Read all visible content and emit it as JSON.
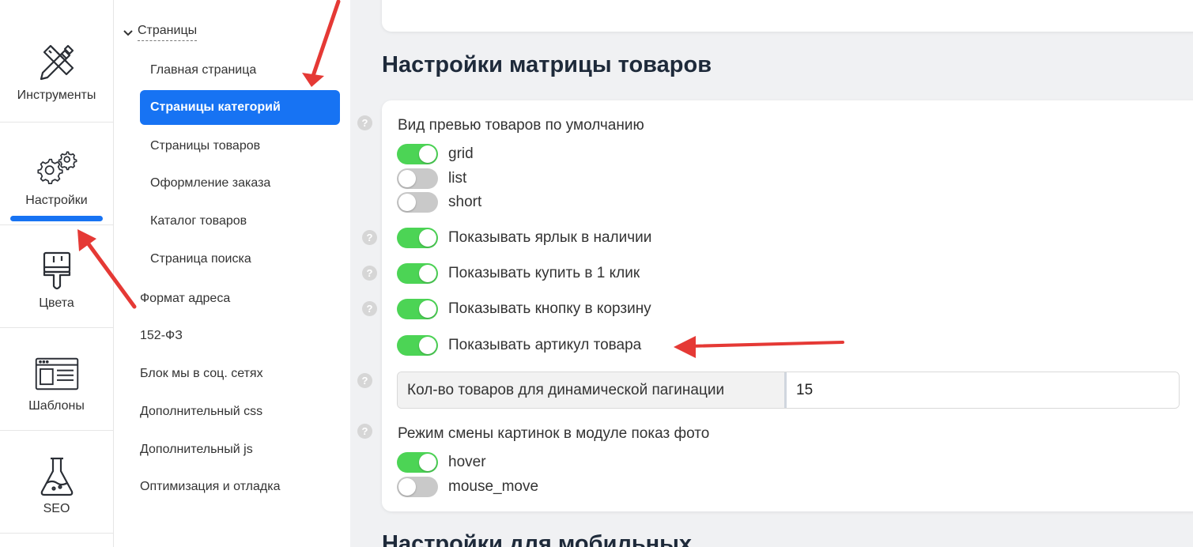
{
  "rail": {
    "items": [
      {
        "label": "Инструменты",
        "icon": "tools-icon"
      },
      {
        "label": "Настройки",
        "icon": "settings-gears-icon"
      },
      {
        "label": "Цвета",
        "icon": "paintbrush-icon"
      },
      {
        "label": "Шаблоны",
        "icon": "template-icon"
      },
      {
        "label": "SEO",
        "icon": "flask-icon"
      }
    ],
    "active": "Настройки"
  },
  "subnav": {
    "section": "Страницы",
    "children": [
      "Главная страница",
      "Страницы категорий",
      "Страницы товаров",
      "Оформление заказа",
      "Каталог товаров",
      "Страница поиска"
    ],
    "active_child": "Страницы категорий",
    "top_items": [
      "Формат адреса",
      "152-ФЗ",
      "Блок мы в соц. сетях",
      "Дополнительный css",
      "Дополнительный js",
      "Оптимизация и отладка"
    ]
  },
  "main": {
    "title": "Настройки матрицы товаров",
    "preview_label": "Вид превью товаров по умолчанию",
    "preview_options": [
      {
        "label": "grid",
        "on": true
      },
      {
        "label": "list",
        "on": false
      },
      {
        "label": "short",
        "on": false
      }
    ],
    "toggles": [
      {
        "label": "Показывать ярлык в наличии",
        "on": true
      },
      {
        "label": "Показывать купить в 1 клик",
        "on": true
      },
      {
        "label": "Показывать кнопку в корзину",
        "on": true
      },
      {
        "label": "Показывать артикул товара",
        "on": true
      }
    ],
    "pagination_label": "Кол-во товаров для динамической пагинации",
    "pagination_value": "15",
    "photo_mode_label": "Режим смены картинок в модуле показ фото",
    "photo_mode_options": [
      {
        "label": "hover",
        "on": true
      },
      {
        "label": "mouse_move",
        "on": false
      }
    ],
    "next_title": "Настройки для мобильных",
    "help_symbol": "?"
  },
  "colors": {
    "accent": "#1773f3",
    "switch_on": "#4cd455",
    "switch_off": "#c9c9c9",
    "annotation_arrow": "#e53935"
  }
}
